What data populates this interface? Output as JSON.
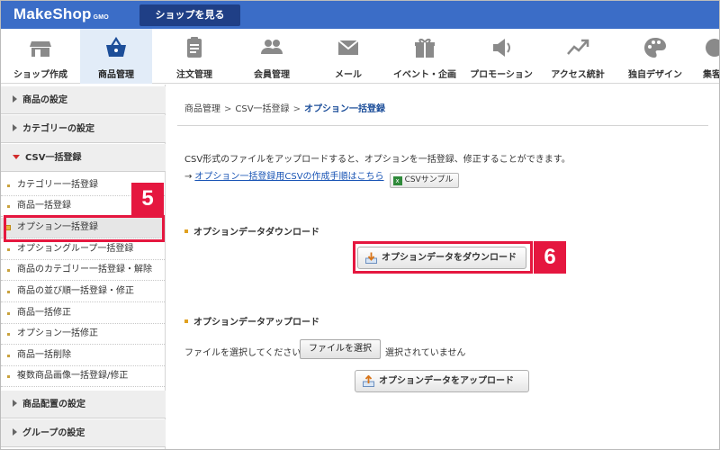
{
  "topbar": {
    "logo_text": "MakeShop",
    "logo_suffix": "GMO",
    "shop_button": "ショップを見る",
    "accent_color": "#3b6dc7"
  },
  "nav": {
    "items": [
      {
        "label": "ショップ作成",
        "icon": "storefront-icon",
        "active": false
      },
      {
        "label": "商品管理",
        "icon": "shopping-basket-icon",
        "active": true
      },
      {
        "label": "注文管理",
        "icon": "clipboard-icon",
        "active": false
      },
      {
        "label": "会員管理",
        "icon": "users-icon",
        "active": false
      },
      {
        "label": "メール",
        "icon": "mail-icon",
        "active": false
      },
      {
        "label": "イベント・企画",
        "icon": "gift-icon",
        "active": false
      },
      {
        "label": "プロモーション",
        "icon": "megaphone-icon",
        "active": false
      },
      {
        "label": "アクセス統計",
        "icon": "trend-line-icon",
        "active": false
      },
      {
        "label": "独自デザイン",
        "icon": "palette-icon",
        "active": false
      },
      {
        "label": "集客",
        "icon": "partial-icon",
        "active": false
      }
    ]
  },
  "sidebar": {
    "head_product_settings": "商品の設定",
    "head_category_settings": "カテゴリーの設定",
    "head_csv_bulk": "CSV一括登録",
    "items": [
      "カテゴリー一括登録",
      "商品一括登録",
      "オプション一括登録",
      "オプショングループ一括登録",
      "商品のカテゴリー一括登録・解除",
      "商品の並び順一括登録・修正",
      "商品一括修正",
      "オプション一括修正",
      "商品一括削除",
      "複数商品画像一括登録/修正"
    ],
    "active_index": 2,
    "head_product_layout": "商品配置の設定",
    "head_group_settings": "グループの設定"
  },
  "callouts": {
    "step5": "5",
    "step6": "6",
    "color": "#e5173f"
  },
  "content": {
    "breadcrumb": {
      "level1": "商品管理",
      "sep": ">",
      "level2": "CSV一括登録",
      "current": "オプション一括登録"
    },
    "description": "CSV形式のファイルをアップロードすると、オプションを一括登録、修正することができます。",
    "howto_arrow": "→",
    "howto_link": "オプション一括登録用CSVの作成手順はこちら",
    "csv_sample_label": "CSVサンプル",
    "download_section_title": "オプションデータダウンロード",
    "download_button": "オプションデータをダウンロード",
    "upload_section_title": "オプションデータアップロード",
    "file_label": "ファイルを選択してください",
    "file_button": "ファイルを選択",
    "file_status": "選択されていません",
    "upload_button": "オプションデータをアップロード"
  }
}
